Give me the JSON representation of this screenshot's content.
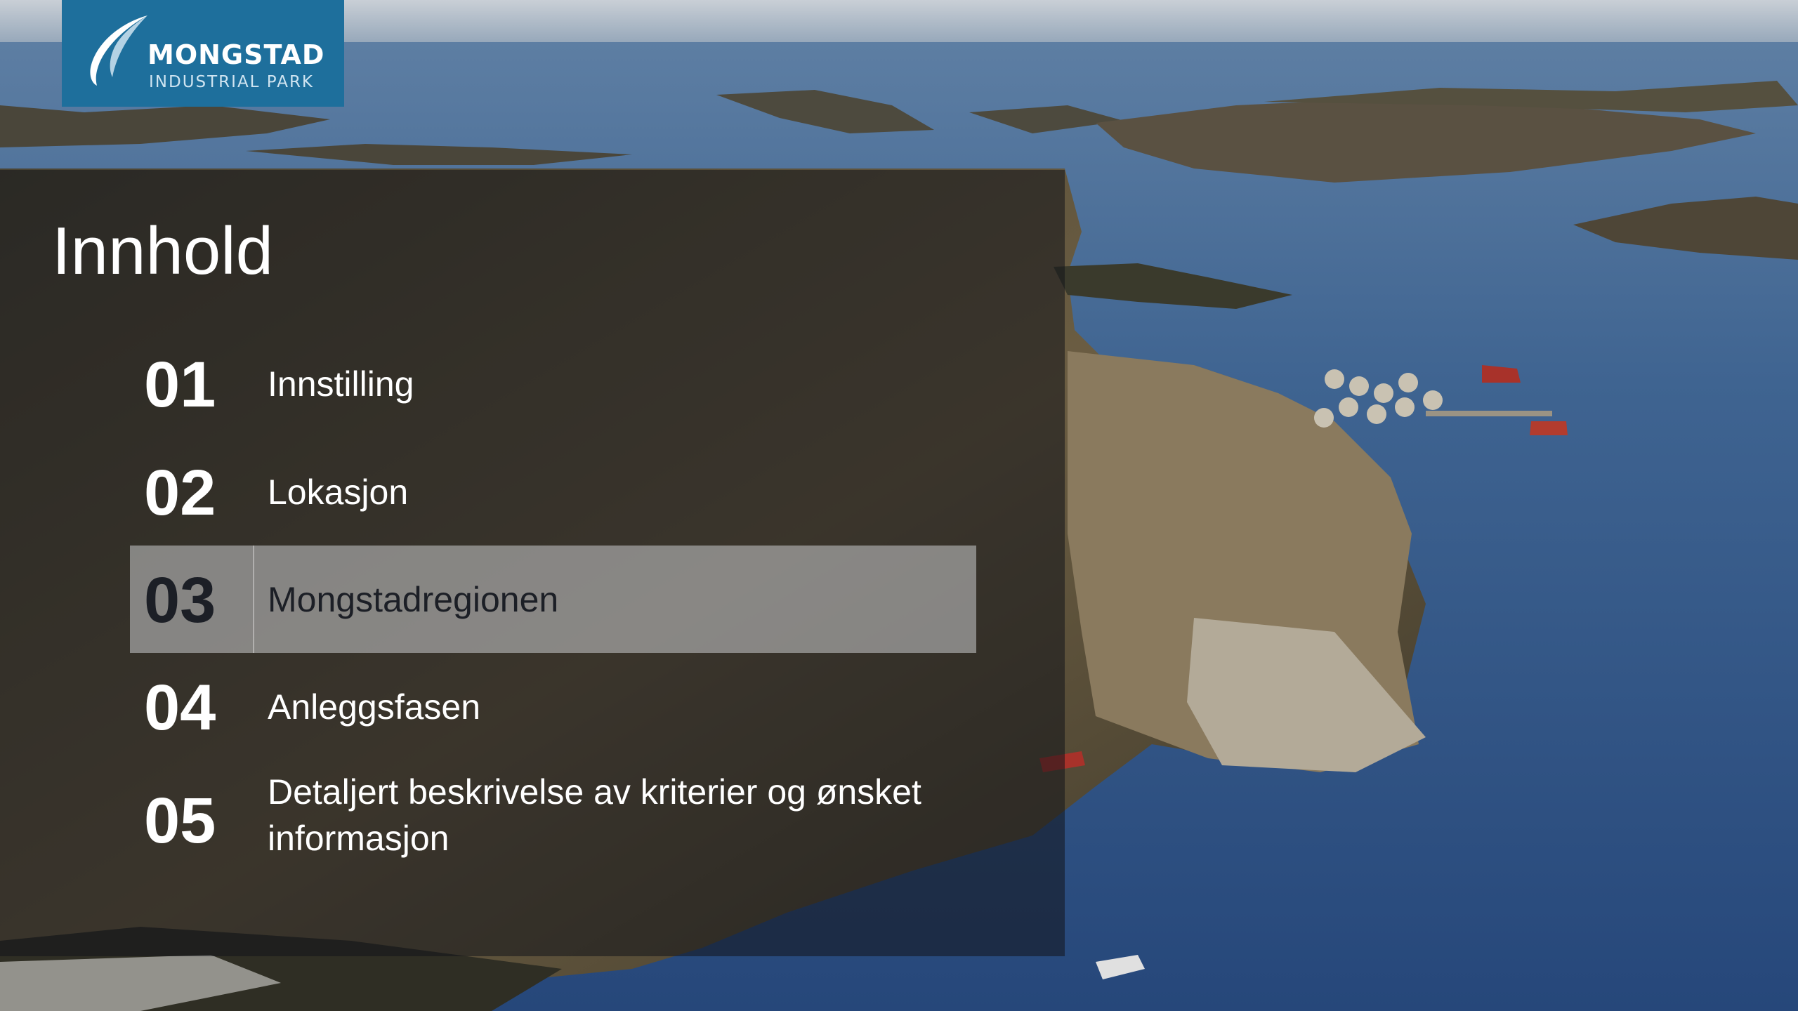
{
  "logo": {
    "name": "MONGSTAD",
    "subtitle": "INDUSTRIAL PARK"
  },
  "heading": "Innhold",
  "toc": [
    {
      "number": "01",
      "label": "Innstilling"
    },
    {
      "number": "02",
      "label": "Lokasjon"
    },
    {
      "number": "03",
      "label": "Mongstadregionen",
      "active": true
    },
    {
      "number": "04",
      "label": "Anleggsfasen"
    },
    {
      "number": "05",
      "label": "Detaljert beskrivelse av kriterier og ønsket informasjon"
    }
  ],
  "colors": {
    "brand_blue": "#1e6f9c",
    "panel_overlay": "#12141a",
    "active_row": "#e8eaee",
    "text_light": "#ffffff",
    "text_dark": "#1c1f26"
  }
}
